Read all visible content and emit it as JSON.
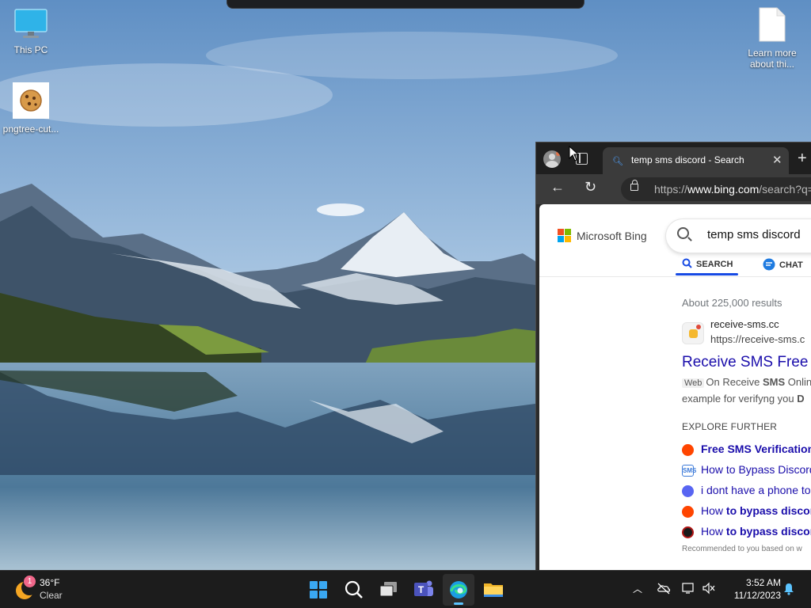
{
  "desktop": {
    "icons": [
      {
        "label": "This PC",
        "icon": "monitor-icon"
      },
      {
        "label": "pngtree-cut...",
        "icon": "cookie-image-icon"
      },
      {
        "label": "Learn more about thi...",
        "icon": "document-icon"
      }
    ]
  },
  "browser": {
    "tab": {
      "title": "temp sms discord - Search",
      "close": "✕"
    },
    "new_tab": "+",
    "nav": {
      "back": "←",
      "refresh": "↻"
    },
    "address": {
      "prefix": "https://",
      "host": "www.bing.com",
      "path": "/search?q="
    }
  },
  "page": {
    "brand": "Microsoft Bing",
    "query": "temp sms discord",
    "scopes": [
      {
        "label": "SEARCH",
        "active": true
      },
      {
        "label": "CHAT",
        "active": false
      }
    ],
    "result_count": "About 225,000 results",
    "result": {
      "site_name": "receive-sms.cc",
      "site_url": "https://receive-sms.c",
      "title": "Receive SMS Free",
      "tag": "Web",
      "snippet_prefix": "On Receive ",
      "snippet_bold": "SMS",
      "snippet_suffix": " Onlin",
      "snippet2_prefix": "example for verifyng you ",
      "snippet2_bold": "D"
    },
    "explore_heading": "EXPLORE FURTHER",
    "explore_items": [
      {
        "pre": "",
        "bold": "Free SMS Verification",
        "icon": "reddit-icon",
        "color": "#ff4500"
      },
      {
        "pre": "How to Bypass Discord",
        "bold": "",
        "icon": "sms-icon",
        "color": "#3d7bd9"
      },
      {
        "pre": "i dont have a phone to",
        "bold": "",
        "icon": "discord-icon",
        "color": "#5865f2"
      },
      {
        "pre": "How ",
        "bold": "to bypass discord",
        "icon": "reddit-icon",
        "color": "#ff4500"
      },
      {
        "pre": "How ",
        "bold": "to bypass discord",
        "icon": "spider-icon",
        "color": "#b01515"
      }
    ],
    "footnote": "Recommended to you based on w"
  },
  "taskbar": {
    "weather": {
      "badge": "1",
      "temp": "36°F",
      "condition": "Clear"
    },
    "apps": [
      "start-icon",
      "search-icon",
      "task-view-icon",
      "teams-icon",
      "edge-icon",
      "file-explorer-icon"
    ],
    "clock": {
      "time": "3:52 AM",
      "date": "11/12/2023"
    }
  }
}
